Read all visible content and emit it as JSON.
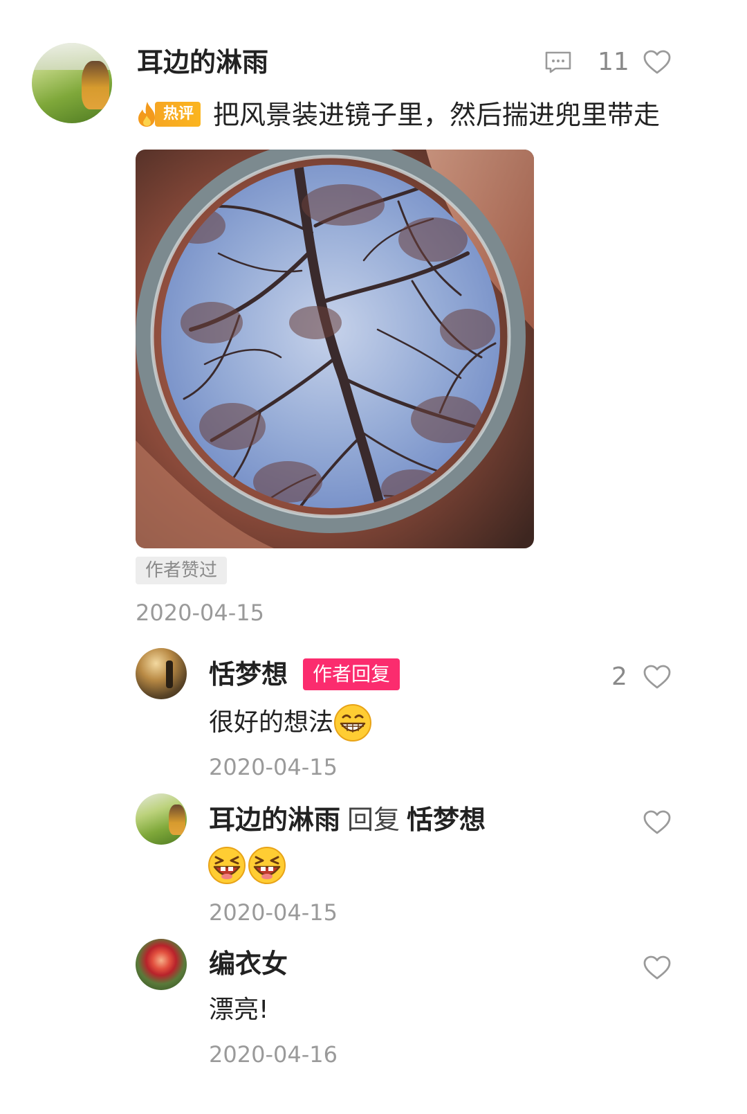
{
  "main_comment": {
    "author": "耳边的淋雨",
    "like_count": "11",
    "hot_badge": "热评",
    "text": "把风景装进镜子里，然后揣进兜里带走",
    "author_liked": "作者赞过",
    "date": "2020-04-15",
    "icons": {
      "reply": "comment-icon",
      "like": "heart-icon",
      "hot": "flame-icon"
    }
  },
  "replies": [
    {
      "author": "恬梦想",
      "badge": "作者回复",
      "like_count": "2",
      "text": "很好的想法",
      "emoji": "grinning-face",
      "date": "2020-04-15"
    },
    {
      "author": "耳边的淋雨",
      "reply_keyword": "回复",
      "reply_to": "恬梦想",
      "emojis": [
        "laughing-face",
        "laughing-face"
      ],
      "date": "2020-04-15"
    },
    {
      "author": "编衣女",
      "text": "漂亮!",
      "date": "2020-04-16"
    }
  ],
  "colors": {
    "hot_badge": "#fbb51f",
    "author_badge": "#fb2c6e",
    "meta_text": "#9a9a9a",
    "body_text": "#222222"
  }
}
